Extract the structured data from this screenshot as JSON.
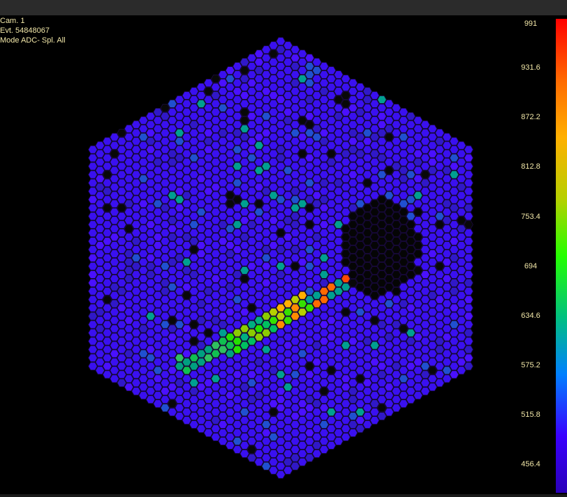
{
  "info": {
    "camera": "Cam. 1",
    "event": "Evt. 54848067",
    "mode": "Mode ADC- Spl. All"
  },
  "scale": {
    "ticks": [
      "991",
      "931.6",
      "872.2",
      "812.8",
      "753.4",
      "694",
      "634.6",
      "575.2",
      "515.8",
      "456.4"
    ],
    "colors": [
      "#ff0000",
      "#ff6a00",
      "#ffb000",
      "#b6d000",
      "#25ff00",
      "#00c080",
      "#0080ff",
      "#3a00ff",
      "#2a00b8"
    ]
  },
  "display": {
    "palette": {
      "background": "#000000",
      "base": "#3a10f0",
      "outline": "#1a0a40"
    }
  }
}
